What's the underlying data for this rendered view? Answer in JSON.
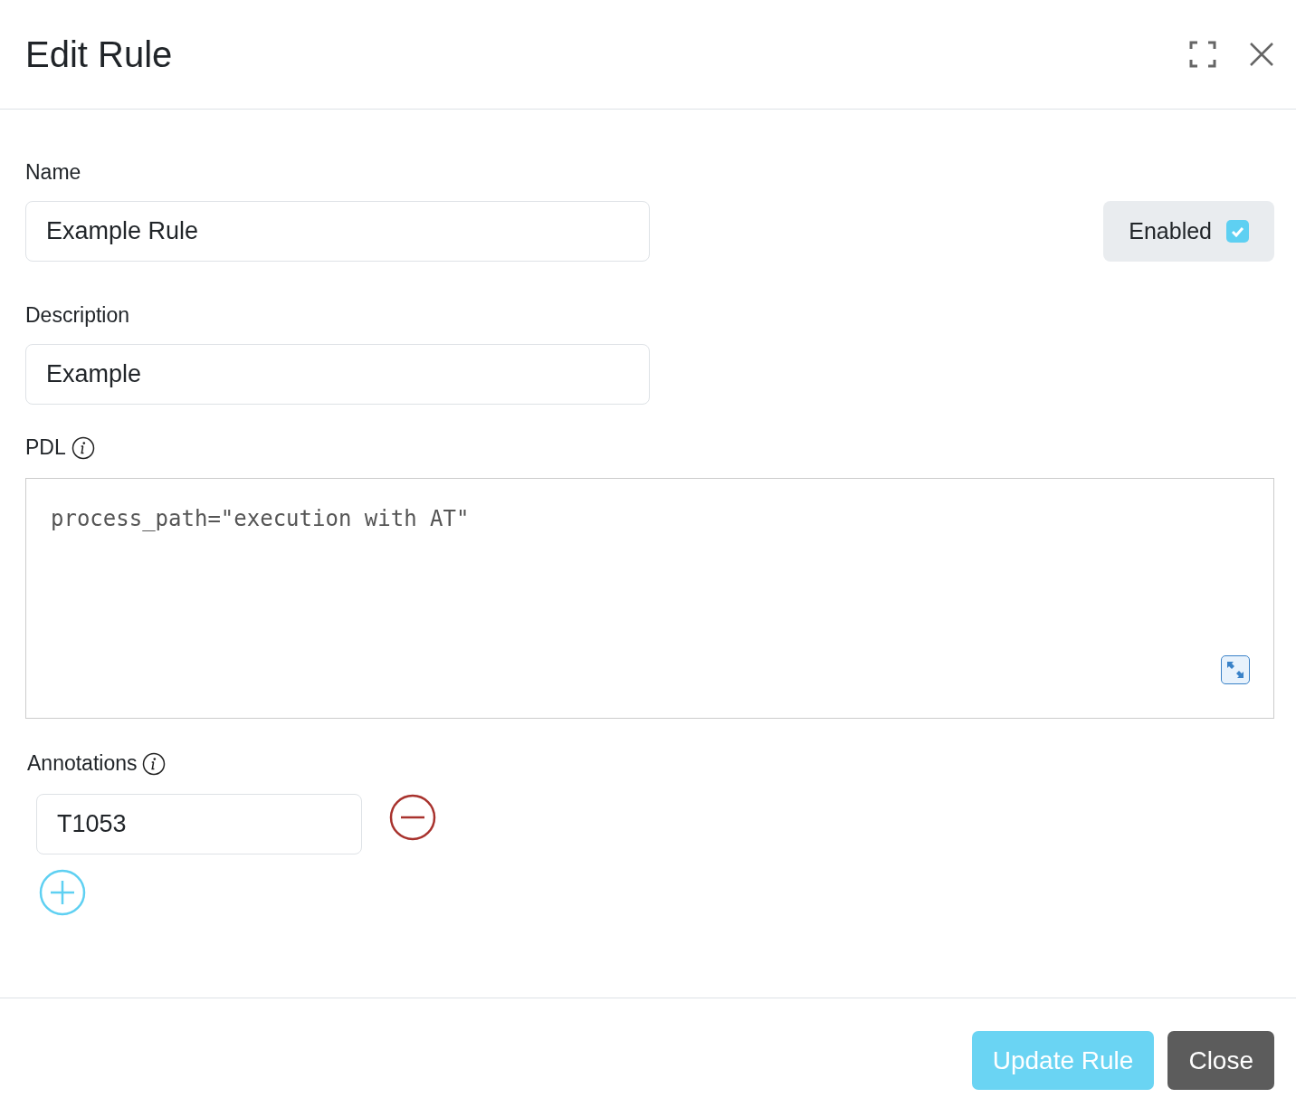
{
  "dialog": {
    "title": "Edit Rule"
  },
  "fields": [
    {
      "label": "Name",
      "value": "Example Rule"
    },
    {
      "label": "Description",
      "value": "Example"
    }
  ],
  "enabled": {
    "label": "Enabled",
    "checked": true
  },
  "pdl": {
    "label": "PDL",
    "code": "process_path=\"execution with AT\""
  },
  "annotations": {
    "label": "Annotations",
    "items": [
      {
        "value": "T1053"
      }
    ]
  },
  "buttons": [
    {
      "label": "Update Rule",
      "kind": "primary",
      "disabled": true
    },
    {
      "label": "Close",
      "kind": "secondary",
      "disabled": false
    }
  ]
}
